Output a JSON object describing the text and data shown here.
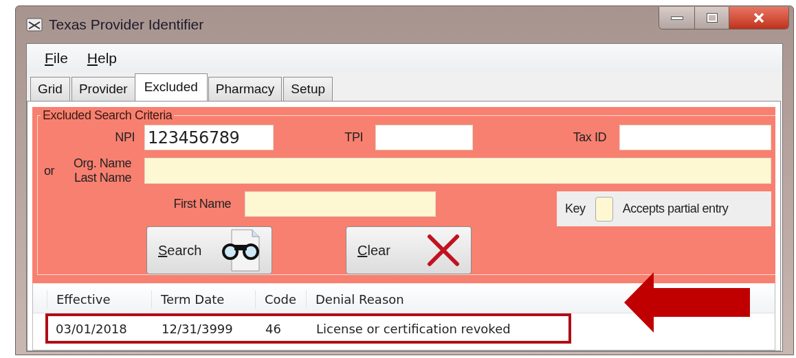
{
  "window": {
    "title": "Texas Provider Identifier"
  },
  "menu": [
    {
      "label": "File"
    },
    {
      "label": "Help"
    }
  ],
  "tabs": [
    {
      "label": "Grid",
      "selected": false
    },
    {
      "label": "Provider",
      "selected": false
    },
    {
      "label": "Excluded",
      "selected": true
    },
    {
      "label": "Pharmacy",
      "selected": false
    },
    {
      "label": "Setup",
      "selected": false
    }
  ],
  "criteria": {
    "title": "Excluded Search Criteria",
    "npi": {
      "label": "NPI",
      "value": "123456789",
      "partial": false
    },
    "tpi": {
      "label": "TPI",
      "partial": false
    },
    "tax_id": {
      "label": "Tax ID",
      "partial": false
    },
    "or_label": "or",
    "name": {
      "labels": [
        "Org. Name",
        "Last Name"
      ],
      "partial": true
    },
    "first_name": {
      "label": "First Name",
      "partial": true
    },
    "key": {
      "label": "Key",
      "text": "Accepts partial entry",
      "partial": true
    },
    "buttons": [
      {
        "label": "Search",
        "kind": "search"
      },
      {
        "label": "Clear",
        "kind": "clear"
      }
    ]
  },
  "table": {
    "columns": [
      "Effective",
      "Term Date",
      "Code",
      "Denial Reason"
    ],
    "rows": [
      {
        "cells": [
          "03/01/2018",
          "12/31/3999",
          "46",
          "License or certification revoked"
        ],
        "highlighted": true
      }
    ]
  },
  "annotation": {
    "kind": "arrow"
  }
}
